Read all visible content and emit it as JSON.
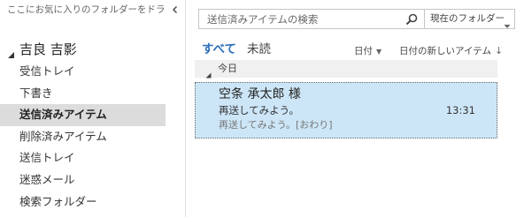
{
  "favorites": {
    "placeholder_text": "ここにお気に入りのフォルダーをドラッグ"
  },
  "account": {
    "name": "吉良 吉影"
  },
  "folders": [
    {
      "label": "受信トレイ",
      "selected": false
    },
    {
      "label": "下書き",
      "selected": false
    },
    {
      "label": "送信済みアイテム",
      "selected": true
    },
    {
      "label": "削除済みアイテム",
      "selected": false
    },
    {
      "label": "送信トレイ",
      "selected": false
    },
    {
      "label": "迷惑メール",
      "selected": false
    },
    {
      "label": "検索フォルダー",
      "selected": false
    }
  ],
  "search": {
    "placeholder": "送信済みアイテムの検索",
    "scope": "現在のフォルダー"
  },
  "filters": {
    "all": "すべて",
    "unread": "未読"
  },
  "sort": {
    "by": "日付",
    "order": "日付の新しいアイテム"
  },
  "groups": [
    {
      "label": "今日",
      "messages": [
        {
          "sender": "空条 承太郎 様",
          "subject": "再送してみよう。",
          "time": "13:31",
          "preview": "再送してみよう。[おわり]"
        }
      ]
    }
  ],
  "colors": {
    "accent": "#2e6fba",
    "selected_message_bg": "#cde6f7",
    "selected_folder_bg": "#dcdcdc"
  }
}
